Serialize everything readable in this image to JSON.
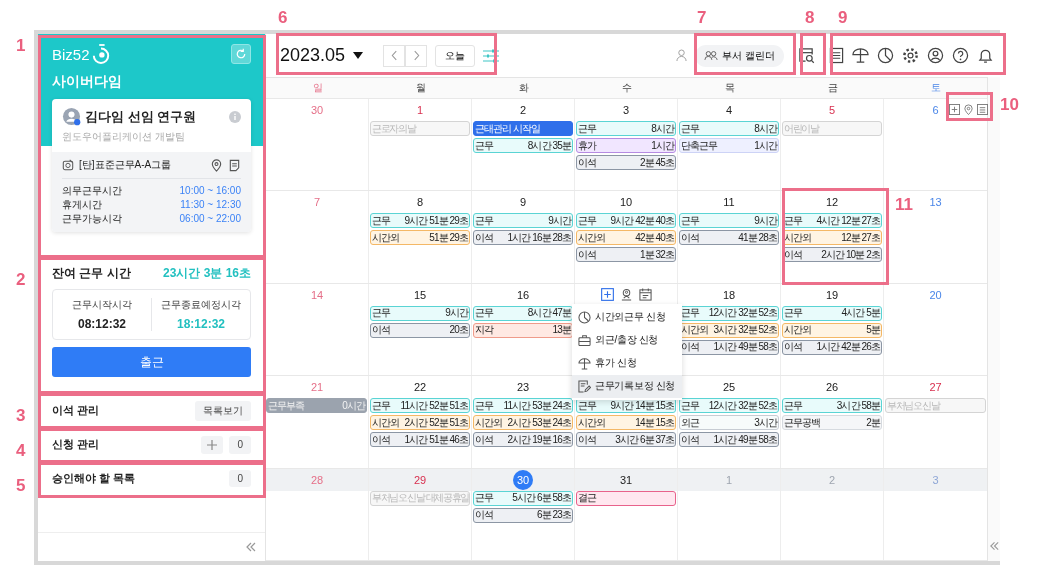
{
  "callouts": [
    {
      "label": "1"
    },
    {
      "label": "2"
    },
    {
      "label": "3"
    },
    {
      "label": "4"
    },
    {
      "label": "5"
    },
    {
      "label": "6"
    },
    {
      "label": "7"
    },
    {
      "label": "8"
    },
    {
      "label": "9"
    },
    {
      "label": "10"
    },
    {
      "label": "11"
    }
  ],
  "sidebar": {
    "logo": "Biz52",
    "company": "사이버다임",
    "user": {
      "name": "김다임 선임 연구원",
      "team": "윈도우어플리케이션 개발팀"
    },
    "work_group": "[탄]표준근무A-A그룹",
    "schedule": [
      {
        "label": "의무근무시간",
        "value": "10:00 ~ 16:00"
      },
      {
        "label": "휴게시간",
        "value": "11:30 ~ 12:30"
      },
      {
        "label": "근무가능시각",
        "value": "06:00 ~ 22:00"
      }
    ],
    "remaining": {
      "label": "잔여 근무 시간",
      "value": "23시간 3분 16초"
    },
    "times": [
      {
        "label": "근무시작시각",
        "value": "08:12:32",
        "kind": "start"
      },
      {
        "label": "근무종료예정시각",
        "value": "18:12:32",
        "kind": "end"
      }
    ],
    "clock_button": "출근",
    "sections": [
      {
        "title": "이석 관리",
        "kind": "list",
        "button": "목록보기"
      },
      {
        "title": "신청 관리",
        "kind": "add",
        "count": "0"
      },
      {
        "title": "승인해야 할 목록",
        "kind": "count",
        "count": "0"
      }
    ]
  },
  "toolbar": {
    "month": "2023.05",
    "today_button": "오늘",
    "dept_calendar": "부서 캘린더"
  },
  "calendar": {
    "weekdays": [
      {
        "label": "일"
      },
      {
        "label": "월"
      },
      {
        "label": "화"
      },
      {
        "label": "수"
      },
      {
        "label": "목"
      },
      {
        "label": "금"
      },
      {
        "label": "토"
      }
    ],
    "weeks": [
      {
        "highlighted": false,
        "days": [
          {
            "date": "30",
            "holiday": false,
            "other_month": false,
            "today": false
          },
          {
            "date": "1",
            "holiday": true,
            "other_month": false,
            "today": false,
            "events": [
              {
                "kind": "holiday",
                "label": "근로자의날"
              }
            ]
          },
          {
            "date": "2",
            "holiday": false,
            "other_month": false,
            "today": false,
            "events": [
              {
                "kind": "start",
                "label": "근태관리 시작일"
              },
              {
                "kind": "work",
                "label": "근무",
                "value": "8시간 35분"
              }
            ]
          },
          {
            "date": "3",
            "holiday": false,
            "other_month": false,
            "today": false,
            "events": [
              {
                "kind": "work",
                "label": "근무",
                "value": "8시간"
              },
              {
                "kind": "leave",
                "label": "휴가",
                "value": "1시간"
              },
              {
                "kind": "away",
                "label": "이석",
                "value": "2분 45초"
              }
            ]
          },
          {
            "date": "4",
            "holiday": false,
            "other_month": false,
            "today": false,
            "events": [
              {
                "kind": "work",
                "label": "근무",
                "value": "8시간"
              },
              {
                "kind": "short",
                "label": "단축근무",
                "value": "1시간"
              }
            ]
          },
          {
            "date": "5",
            "holiday": true,
            "other_month": false,
            "today": false,
            "events": [
              {
                "kind": "holiday",
                "label": "어린이날"
              }
            ]
          },
          {
            "date": "6",
            "holiday": false,
            "other_month": false,
            "today": false,
            "tools": true
          }
        ]
      },
      {
        "highlighted": false,
        "days": [
          {
            "date": "7",
            "holiday": false,
            "other_month": false,
            "today": false
          },
          {
            "date": "8",
            "holiday": false,
            "other_month": false,
            "today": false,
            "events": [
              {
                "kind": "work",
                "label": "근무",
                "value": "9시간 51분 29초"
              },
              {
                "kind": "overtime",
                "label": "시간외",
                "value": "51분 29초"
              }
            ]
          },
          {
            "date": "9",
            "holiday": false,
            "other_month": false,
            "today": false,
            "events": [
              {
                "kind": "work",
                "label": "근무",
                "value": "9시간"
              },
              {
                "kind": "away",
                "label": "이석",
                "value": "1시간 16분 28초"
              }
            ]
          },
          {
            "date": "10",
            "holiday": false,
            "other_month": false,
            "today": false,
            "events": [
              {
                "kind": "work",
                "label": "근무",
                "value": "9시간 42분 40초"
              },
              {
                "kind": "overtime",
                "label": "시간외",
                "value": "42분 40초"
              },
              {
                "kind": "away",
                "label": "이석",
                "value": "1분 32초"
              }
            ]
          },
          {
            "date": "11",
            "holiday": false,
            "other_month": false,
            "today": false,
            "events": [
              {
                "kind": "work",
                "label": "근무",
                "value": "9시간"
              },
              {
                "kind": "away",
                "label": "이석",
                "value": "41분 28초"
              }
            ]
          },
          {
            "date": "12",
            "holiday": false,
            "other_month": false,
            "today": false,
            "events": [
              {
                "kind": "work",
                "label": "근무",
                "value": "4시간 12분 27초"
              },
              {
                "kind": "overtime",
                "label": "시간외",
                "value": "12분 27초"
              },
              {
                "kind": "away",
                "label": "이석",
                "value": "2시간 10분 2초"
              }
            ]
          },
          {
            "date": "13",
            "holiday": false,
            "other_month": false,
            "today": false
          }
        ]
      },
      {
        "highlighted": false,
        "days": [
          {
            "date": "14",
            "holiday": false,
            "other_month": false,
            "today": false
          },
          {
            "date": "15",
            "holiday": false,
            "other_month": false,
            "today": false,
            "events": [
              {
                "kind": "work",
                "label": "근무",
                "value": "9시간"
              },
              {
                "kind": "away",
                "label": "이석",
                "value": "20초"
              }
            ]
          },
          {
            "date": "16",
            "holiday": false,
            "other_month": false,
            "today": false,
            "events": [
              {
                "kind": "work",
                "label": "근무",
                "value": "8시간 47분"
              },
              {
                "kind": "late",
                "label": "지각",
                "value": "13분"
              }
            ]
          },
          {
            "tools": true,
            "menu": [
              {
                "kind": "overtime",
                "label": "시간외근무 신청",
                "selected": false
              },
              {
                "kind": "outside",
                "label": "외근/출장 신청",
                "selected": false
              },
              {
                "kind": "leave",
                "label": "휴가 신청",
                "selected": false
              },
              {
                "kind": "correction",
                "label": "근무기록보정 신청",
                "selected": true
              }
            ]
          },
          {
            "date": "18",
            "holiday": false,
            "other_month": false,
            "today": false,
            "events": [
              {
                "kind": "work",
                "label": "근무",
                "value": "12시간 32분 52초"
              },
              {
                "kind": "overtime",
                "label": "시간외",
                "value": "3시간 32분 52초"
              },
              {
                "kind": "away",
                "label": "이석",
                "value": "1시간 49분 58초"
              }
            ]
          },
          {
            "date": "19",
            "holiday": false,
            "other_month": false,
            "today": false,
            "events": [
              {
                "kind": "work",
                "label": "근무",
                "value": "4시간 5분"
              },
              {
                "kind": "overtime",
                "label": "시간외",
                "value": "5분"
              },
              {
                "kind": "away",
                "label": "이석",
                "value": "1시간 42분 26초"
              }
            ]
          },
          {
            "date": "20",
            "holiday": false,
            "other_month": false,
            "today": false
          }
        ]
      },
      {
        "highlighted": false,
        "days": [
          {
            "date": "21",
            "holiday": false,
            "other_month": false,
            "today": false,
            "events": [
              {
                "kind": "shortage",
                "label": "근무부족",
                "value": "0시간"
              }
            ]
          },
          {
            "date": "22",
            "holiday": false,
            "other_month": false,
            "today": false,
            "events": [
              {
                "kind": "work",
                "label": "근무",
                "value": "11시간 52분 51초"
              },
              {
                "kind": "overtime",
                "label": "시간외",
                "value": "2시간 52분 51초"
              },
              {
                "kind": "away",
                "label": "이석",
                "value": "1시간 51분 46초"
              }
            ]
          },
          {
            "date": "23",
            "holiday": false,
            "other_month": false,
            "today": false,
            "events": [
              {
                "kind": "work",
                "label": "근무",
                "value": "11시간 53분 24초"
              },
              {
                "kind": "overtime",
                "label": "시간외",
                "value": "2시간 53분 24초"
              },
              {
                "kind": "away",
                "label": "이석",
                "value": "2시간 19분 16초"
              }
            ]
          },
          {
            "events": [
              {
                "kind": "work",
                "label": "근무",
                "value": "9시간 14분 15초"
              },
              {
                "kind": "overtime",
                "label": "시간외",
                "value": "14분 15초"
              },
              {
                "kind": "away",
                "label": "이석",
                "value": "3시간 6분 37초"
              }
            ]
          },
          {
            "date": "25",
            "holiday": false,
            "other_month": false,
            "today": false,
            "events": [
              {
                "kind": "work",
                "label": "근무",
                "value": "12시간 32분 52초"
              },
              {
                "kind": "outside",
                "label": "외근",
                "value": "3시간"
              },
              {
                "kind": "away",
                "label": "이석",
                "value": "1시간 49분 58초"
              }
            ]
          },
          {
            "date": "26",
            "holiday": false,
            "other_month": false,
            "today": false,
            "events": [
              {
                "kind": "work",
                "label": "근무",
                "value": "3시간 58분"
              },
              {
                "kind": "gap",
                "label": "근무공백",
                "value": "2분"
              }
            ]
          },
          {
            "date": "27",
            "holiday": true,
            "other_month": false,
            "today": false,
            "events": [
              {
                "kind": "holiday",
                "label": "부처님오신날"
              }
            ]
          }
        ]
      },
      {
        "highlighted": true,
        "days": [
          {
            "date": "28",
            "holiday": false,
            "other_month": false,
            "today": false
          },
          {
            "date": "29",
            "holiday": true,
            "other_month": false,
            "today": false,
            "events": [
              {
                "kind": "holiday",
                "label": "부처님오신날 대체공휴일"
              }
            ]
          },
          {
            "date": "30",
            "holiday": false,
            "other_month": false,
            "today": true,
            "events": [
              {
                "kind": "work",
                "label": "근무",
                "value": "5시간 6분 58초"
              },
              {
                "kind": "away",
                "label": "이석",
                "value": "6분 23초"
              }
            ]
          },
          {
            "date": "31",
            "holiday": false,
            "other_month": false,
            "today": false,
            "events": [
              {
                "kind": "absent",
                "label": "결근"
              }
            ]
          },
          {
            "date": "1",
            "holiday": false,
            "other_month": true,
            "today": false
          },
          {
            "date": "2",
            "holiday": false,
            "other_month": true,
            "today": false
          },
          {
            "date": "3",
            "holiday": false,
            "other_month": true,
            "today": false
          }
        ]
      }
    ]
  }
}
